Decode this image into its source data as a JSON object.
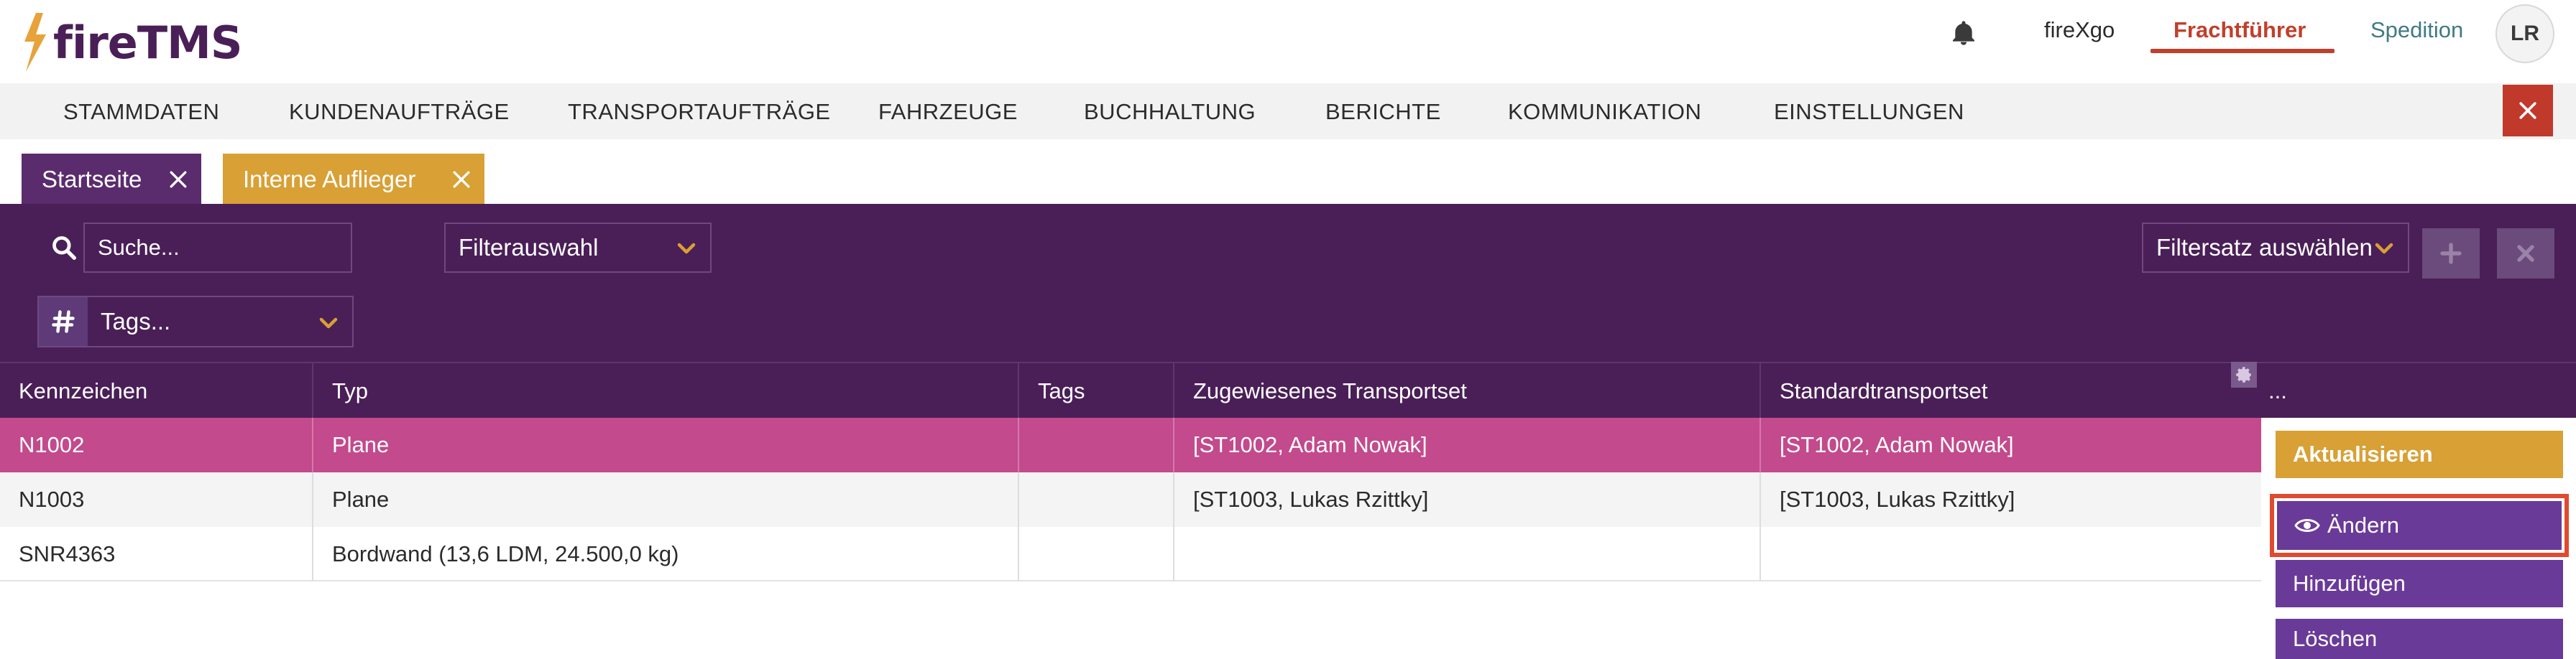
{
  "app": {
    "logo_text": "fireTMS"
  },
  "header": {
    "links": {
      "firexgo": "fireXgo",
      "frachtfuehrer": "Frachtführer",
      "spedition": "Spedition"
    },
    "avatar_initials": "LR"
  },
  "menu": {
    "items": [
      "STAMMDATEN",
      "KUNDENAUFTRÄGE",
      "TRANSPORTAUFTRÄGE",
      "FAHRZEUGE",
      "BUCHHALTUNG",
      "BERICHTE",
      "KOMMUNIKATION",
      "EINSTELLUNGEN"
    ]
  },
  "tabs": [
    {
      "label": "Startseite"
    },
    {
      "label": "Interne Auflieger"
    }
  ],
  "filters": {
    "search_placeholder": "Suche...",
    "filterauswahl": "Filterauswahl",
    "filtersatz": "Filtersatz auswählen",
    "tags": "Tags..."
  },
  "table": {
    "columns": [
      "Kennzeichen",
      "Typ",
      "Tags",
      "Zugewiesenes Transportset",
      "Standardtransportset"
    ],
    "more_label": "...",
    "rows": [
      [
        "N1002",
        "Plane",
        "",
        "[ST1002, Adam Nowak]",
        "[ST1002, Adam Nowak]"
      ],
      [
        "N1003",
        "Plane",
        "",
        "[ST1003, Lukas Rzittky]",
        "[ST1003, Lukas Rzittky]"
      ],
      [
        "SNR4363",
        "Bordwand (13,6 LDM, 24.500,0 kg)",
        "",
        "",
        ""
      ]
    ],
    "selected_row": 0
  },
  "actions": {
    "update": "Aktualisieren",
    "edit": "Ändern",
    "add": "Hinzufügen",
    "delete": "Löschen"
  },
  "colors": {
    "brand_purple": "#4a1f57",
    "accent_orange": "#d8a035",
    "selected_row": "#c34a8c",
    "action_purple": "#6a3a98",
    "danger_red": "#c0392b",
    "active_link": "#c0402d"
  },
  "icons": [
    "bolt-logo-icon",
    "bell-icon",
    "close-icon",
    "search-icon",
    "chevron-down-icon",
    "plus-icon",
    "hash-icon",
    "gear-icon",
    "eye-icon"
  ]
}
